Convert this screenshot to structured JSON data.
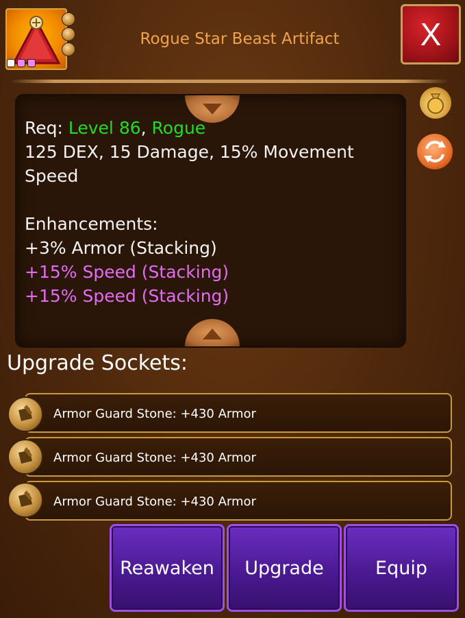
{
  "item": {
    "icon": "artifact-triangle-icon",
    "rarity_dots": [
      "#f5f5f5",
      "#ee88f0",
      "#ee88f0"
    ],
    "title": "Rogue Star Beast Artifact",
    "title_color": "#f0a34a"
  },
  "close_label": "X",
  "description": {
    "req_label": "Req:",
    "req_level": "Level 86",
    "req_sep": ",",
    "req_class": "Rogue",
    "stats": "125 DEX, 15 Damage, 15% Movement Speed",
    "enh_heading": "Enhancements:",
    "enhancements": [
      {
        "text": "+3% Armor (Stacking)",
        "color": "#f4f4f4"
      },
      {
        "text": "+15% Speed (Stacking)",
        "color": "#e36cf0"
      },
      {
        "text": "+15% Speed (Stacking)",
        "color": "#e36cf0"
      }
    ]
  },
  "side_icons": [
    "gold-bag-icon",
    "refresh-icon"
  ],
  "sockets": {
    "heading": "Upgrade Sockets:",
    "items": [
      {
        "label": "Armor Guard Stone: +430 Armor",
        "icon": "armor-guard-stone-icon"
      },
      {
        "label": "Armor Guard Stone: +430 Armor",
        "icon": "armor-guard-stone-icon"
      },
      {
        "label": "Armor Guard Stone: +430 Armor",
        "icon": "armor-guard-stone-icon"
      }
    ]
  },
  "actions": {
    "reawaken": "Reawaken",
    "upgrade": "Upgrade",
    "equip": "Equip"
  },
  "colors": {
    "requirement_green": "#22dd22",
    "enhancement_pink": "#e36cf0",
    "button_purple": "#48188e",
    "close_red": "#a5141a"
  }
}
